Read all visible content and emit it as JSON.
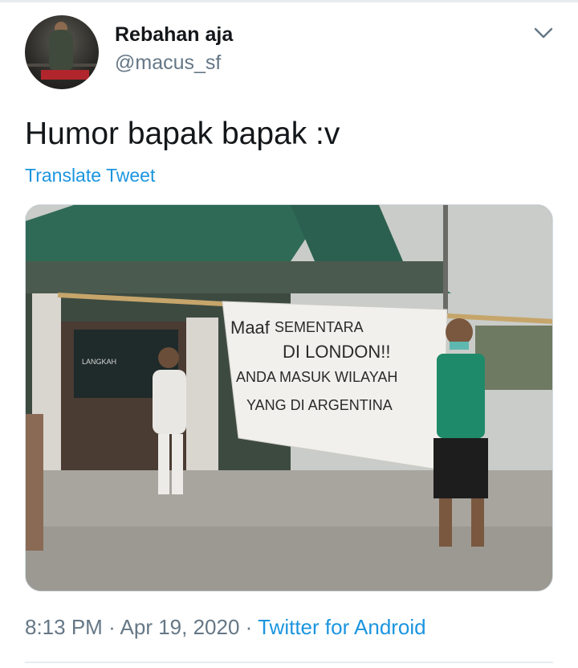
{
  "tweet": {
    "author": {
      "display_name": "Rebahan aja",
      "handle": "@macus_sf"
    },
    "text": "Humor bapak bapak :v",
    "translate_label": "Translate Tweet",
    "timestamp": {
      "time": "8:13 PM",
      "date": "Apr 19, 2020",
      "source": "Twitter for Android",
      "separator": "·"
    },
    "media": {
      "banner": {
        "line1a": "Maaf",
        "line1b": "SEMENTARA",
        "line2": "DI LONDON!!",
        "line3": "ANDA MASUK WILAYAH",
        "line4": "YANG DI ARGENTINA"
      },
      "sign_text": "LANGKAH"
    }
  },
  "colors": {
    "link": "#1b95e0",
    "secondary_text": "#657786",
    "primary_text": "#14171a"
  },
  "icons": {
    "menu": "chevron-down-icon"
  }
}
